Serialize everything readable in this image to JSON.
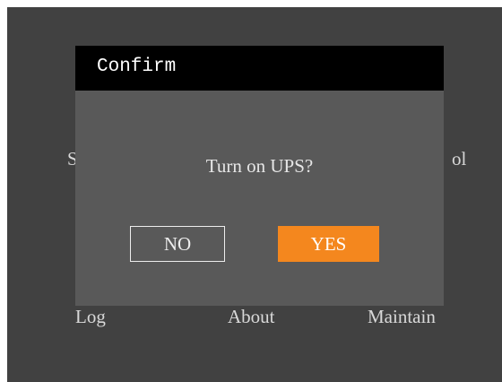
{
  "menu": {
    "items_row1": [
      {
        "label": "S"
      },
      {
        "label": "ol"
      }
    ],
    "items_row2": [
      {
        "label": "Log"
      },
      {
        "label": "About"
      },
      {
        "label": "Maintain"
      }
    ]
  },
  "dialog": {
    "title": "Confirm",
    "message": "Turn on UPS?",
    "no_label": "NO",
    "yes_label": "YES"
  },
  "colors": {
    "screen_background": "#414141",
    "dialog_background": "#595959",
    "titlebar_background": "#000000",
    "yes_button": "#f4871e"
  }
}
